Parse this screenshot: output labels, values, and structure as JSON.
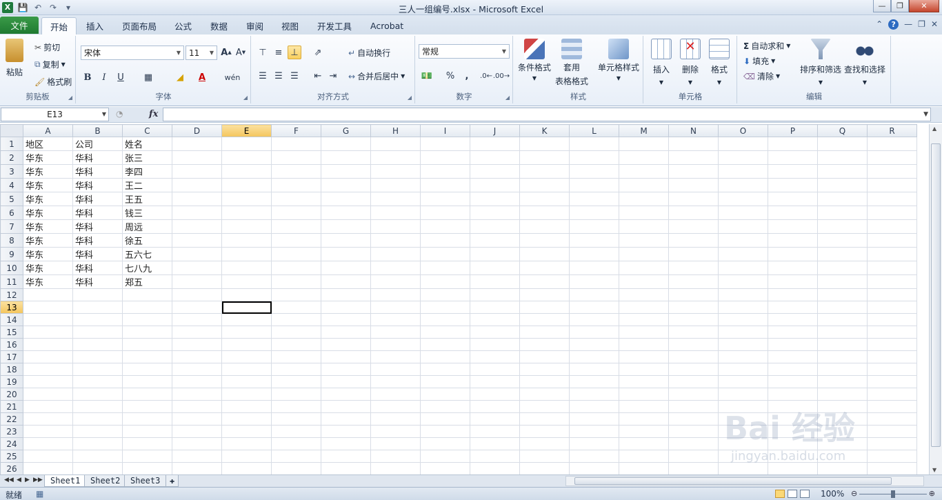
{
  "window": {
    "title": "三人一组编号.xlsx - Microsoft Excel"
  },
  "tabs": [
    "文件",
    "开始",
    "插入",
    "页面布局",
    "公式",
    "数据",
    "审阅",
    "视图",
    "开发工具",
    "Acrobat"
  ],
  "active_tab": "开始",
  "ribbon": {
    "clipboard": {
      "label": "剪贴板",
      "paste": "粘贴",
      "cut": "剪切",
      "copy": "复制",
      "format_painter": "格式刷"
    },
    "font": {
      "label": "字体",
      "font_name": "宋体",
      "font_size": "11",
      "bold": "B",
      "italic": "I",
      "underline": "U"
    },
    "alignment": {
      "label": "对齐方式",
      "wrap_text": "自动换行",
      "merge_center": "合并后居中"
    },
    "number": {
      "label": "数字",
      "format": "常规",
      "percent": "%",
      "comma": ","
    },
    "styles": {
      "label": "样式",
      "conditional": "条件格式",
      "table_format_1": "套用",
      "table_format_2": "表格格式",
      "cell_styles": "单元格样式"
    },
    "cells": {
      "label": "单元格",
      "insert": "插入",
      "delete": "删除",
      "format": "格式"
    },
    "editing": {
      "label": "编辑",
      "autosum": "自动求和",
      "fill": "填充",
      "clear": "清除",
      "sort_filter": "排序和筛选",
      "find_select": "查找和选择"
    }
  },
  "formula_bar": {
    "name_box": "E13",
    "fx": "fx",
    "value": ""
  },
  "grid": {
    "columns": [
      "A",
      "B",
      "C",
      "D",
      "E",
      "F",
      "G",
      "H",
      "I",
      "J",
      "K",
      "L",
      "M",
      "N",
      "O",
      "P",
      "Q",
      "R"
    ],
    "selected_column": "E",
    "selected_row": 13,
    "rows": [
      [
        "地区",
        "公司",
        "姓名"
      ],
      [
        "华东",
        "华科",
        "张三"
      ],
      [
        "华东",
        "华科",
        "李四"
      ],
      [
        "华东",
        "华科",
        "王二"
      ],
      [
        "华东",
        "华科",
        "王五"
      ],
      [
        "华东",
        "华科",
        "钱三"
      ],
      [
        "华东",
        "华科",
        "周远"
      ],
      [
        "华东",
        "华科",
        "徐五"
      ],
      [
        "华东",
        "华科",
        "五六七"
      ],
      [
        "华东",
        "华科",
        "七八九"
      ],
      [
        "华东",
        "华科",
        "郑五"
      ]
    ],
    "row_count": 27
  },
  "sheets": [
    "Sheet1",
    "Sheet2",
    "Sheet3"
  ],
  "active_sheet": "Sheet1",
  "status": {
    "ready": "就绪",
    "zoom": "100%"
  },
  "watermark": {
    "main": "Bai 经验",
    "sub": "jingyan.baidu.com"
  }
}
